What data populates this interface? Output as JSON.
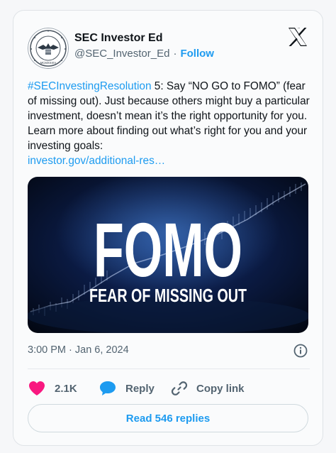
{
  "account": {
    "name": "SEC Investor Ed",
    "handle": "@SEC_Investor_Ed",
    "separator": "·",
    "follow_label": "Follow",
    "seal_roman": "MCMXXXIV"
  },
  "tweet": {
    "hashtag": "#SECInvestingResolution",
    "line_1": " 5: Say “NO GO to FOMO” (fear of missing out). Just because others might buy a particular investment, doesn’t mean it’s the right opportunity for you. Learn more about finding out what’s right for you and your investing goals:",
    "link": "investor.gov/additional-res…"
  },
  "media": {
    "title": "FOMO",
    "subtitle": "FEAR OF MISSING OUT"
  },
  "meta": {
    "timestamp": "3:00 PM · Jan 6, 2024"
  },
  "actions": {
    "likes": "2.1K",
    "reply_label": "Reply",
    "copy_label": "Copy link"
  },
  "read_replies_label": "Read 546 replies",
  "colors": {
    "accent": "#1d9bf0",
    "like": "#f91880",
    "reply_icon": "#1d9bf0"
  },
  "icons": [
    "sec-seal-icon",
    "x-logo-icon",
    "info-icon",
    "heart-icon",
    "reply-bubble-icon",
    "link-icon"
  ]
}
